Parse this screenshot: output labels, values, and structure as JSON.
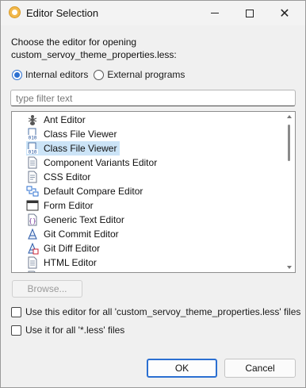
{
  "window": {
    "title": "Editor Selection"
  },
  "prompt": {
    "line1": "Choose the editor for opening",
    "line2": "custom_servoy_theme_properties.less:"
  },
  "source": {
    "internal_label": "Internal editors",
    "external_label": "External programs",
    "selected": "internal"
  },
  "filter": {
    "placeholder": "type filter text",
    "value": ""
  },
  "editors": [
    {
      "label": "Ant Editor",
      "icon": "ant-editor-icon",
      "selected": false
    },
    {
      "label": "Class File Viewer",
      "icon": "class-file-icon",
      "selected": false
    },
    {
      "label": "Class File Viewer",
      "icon": "class-file-icon",
      "selected": true
    },
    {
      "label": "Component Variants Editor",
      "icon": "document-icon",
      "selected": false
    },
    {
      "label": "CSS Editor",
      "icon": "css-file-icon",
      "selected": false
    },
    {
      "label": "Default Compare Editor",
      "icon": "compare-icon",
      "selected": false
    },
    {
      "label": "Form Editor",
      "icon": "form-icon",
      "selected": false
    },
    {
      "label": "Generic Text Editor",
      "icon": "generic-text-icon",
      "selected": false
    },
    {
      "label": "Git Commit Editor",
      "icon": "git-commit-icon",
      "selected": false
    },
    {
      "label": "Git Diff Editor",
      "icon": "git-diff-icon",
      "selected": false
    },
    {
      "label": "HTML Editor",
      "icon": "html-file-icon",
      "selected": false
    },
    {
      "label": "HTML Editor",
      "icon": "html-file-icon",
      "selected": false
    }
  ],
  "browse_label": "Browse...",
  "options": {
    "all_files_label": "Use this editor for all 'custom_servoy_theme_properties.less' files",
    "all_ext_label": "Use it for all '*.less' files"
  },
  "buttons": {
    "ok": "OK",
    "cancel": "Cancel"
  }
}
